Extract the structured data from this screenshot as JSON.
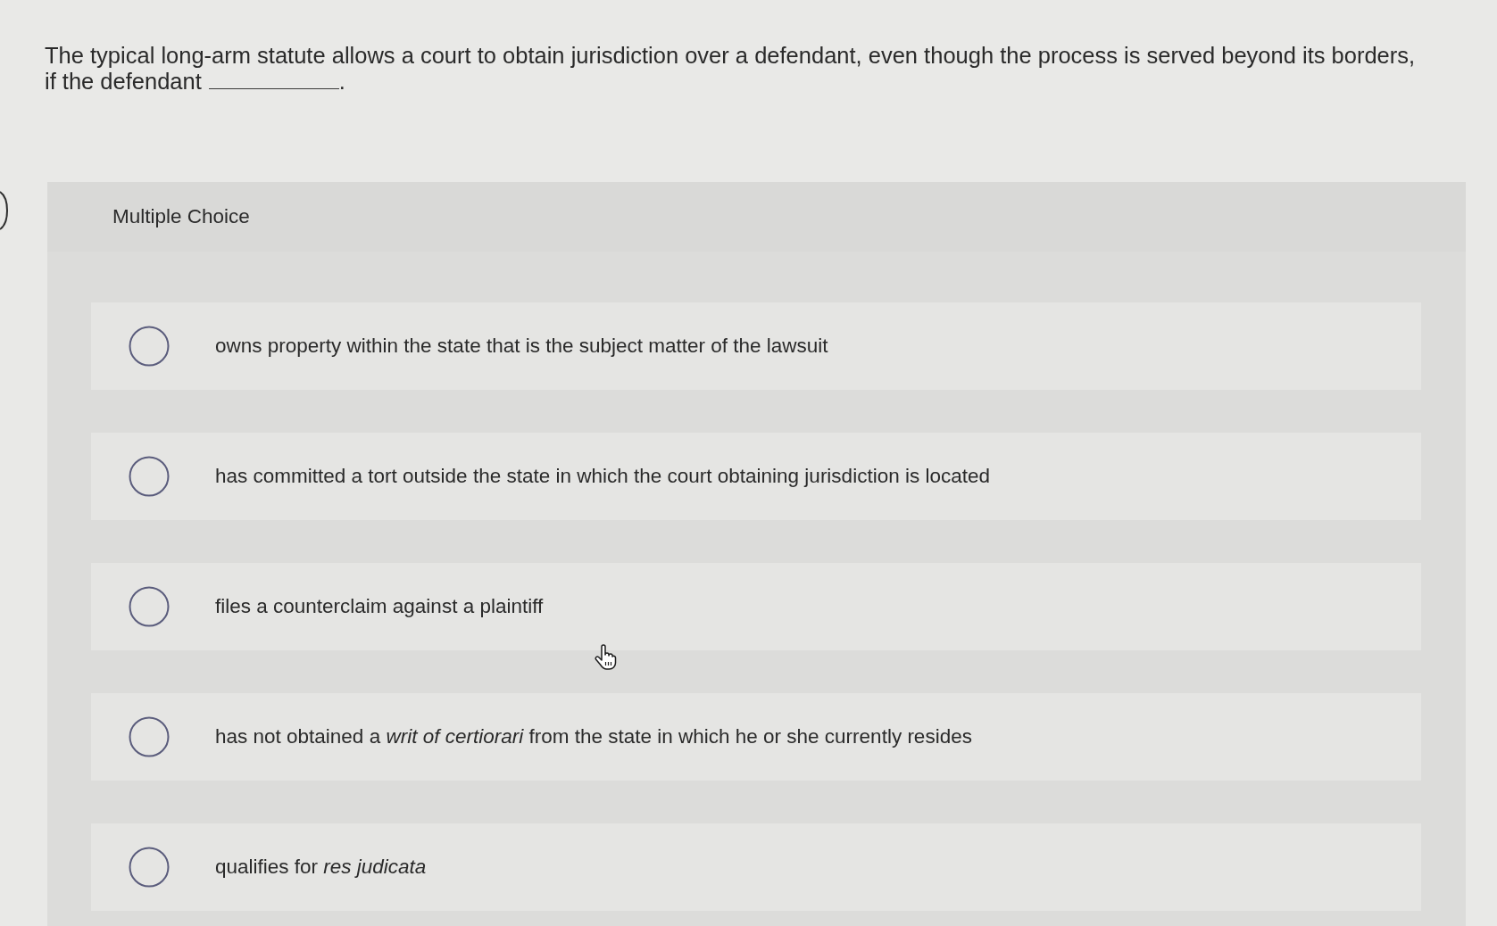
{
  "question": {
    "text_before": "The typical long-arm statute allows a court to obtain jurisdiction over a defendant, even though the process is served beyond its borders, if the defendant",
    "text_after": "."
  },
  "panel": {
    "heading": "Multiple Choice"
  },
  "options": [
    {
      "text": "owns property within the state that is the subject matter of the lawsuit",
      "selected": false
    },
    {
      "text": "has committed a tort outside the state in which the court obtaining jurisdiction is located",
      "selected": false
    },
    {
      "text": "files a counterclaim against a plaintiff",
      "selected": false
    },
    {
      "text": "has not obtained a *writ of certiorari* from the state in which he or she currently resides",
      "selected": false
    },
    {
      "text": "qualifies for *res judicata*",
      "selected": false
    }
  ]
}
